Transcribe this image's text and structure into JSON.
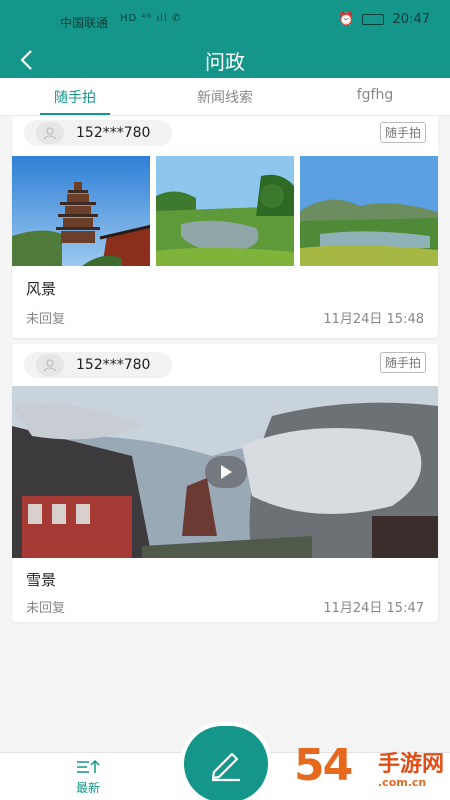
{
  "status_bar": {
    "carrier": "中国联通",
    "icons": "HD ⁴ᴳ ıll ✆",
    "time": "20:47"
  },
  "navbar": {
    "title": "问政"
  },
  "tabs": [
    {
      "label": "随手拍",
      "active": true
    },
    {
      "label": "新闻线索",
      "active": false
    },
    {
      "label": "fgfhg",
      "active": false
    }
  ],
  "posts": [
    {
      "user": "152***780",
      "tag": "随手拍",
      "title": "风景",
      "status": "未回复",
      "time": "11月24日 15:48"
    },
    {
      "user": "152***780",
      "tag": "随手拍",
      "title": "雪景",
      "status": "未回复",
      "time": "11月24日 15:47"
    }
  ],
  "bottom": {
    "latest_label": "最新"
  },
  "watermark": {
    "big": "54",
    "small": "手游网",
    "sub": ".com.cn"
  },
  "colors": {
    "primary": "#14978a",
    "watermark": "#e56a1f"
  }
}
